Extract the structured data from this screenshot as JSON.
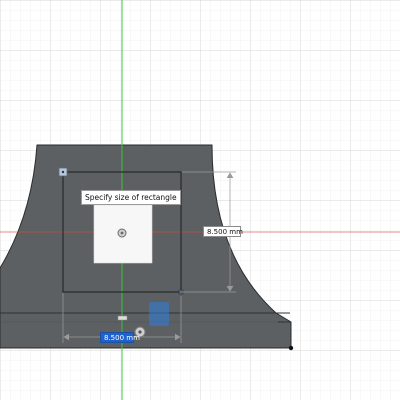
{
  "colors": {
    "background": "#ffffff",
    "grid_minor": "#e8e8e8",
    "grid_major": "#d4d4d4",
    "y_axis": "#3cc43c",
    "x_axis": "#d84a3a",
    "body_fill": "#5c6062",
    "body_edge": "#2a2c2d",
    "sketch_line": "#1c1c1c",
    "selection": "#1e62d0"
  },
  "tooltip": {
    "text": "Specify size of rectangle"
  },
  "dimensions": {
    "height_value": "8.500 mm",
    "width_value": "8.500 mm"
  },
  "icons": [
    "sketch-origin-icon",
    "corner-point-icon",
    "cursor-icon",
    "constraint-glyph-icon"
  ]
}
